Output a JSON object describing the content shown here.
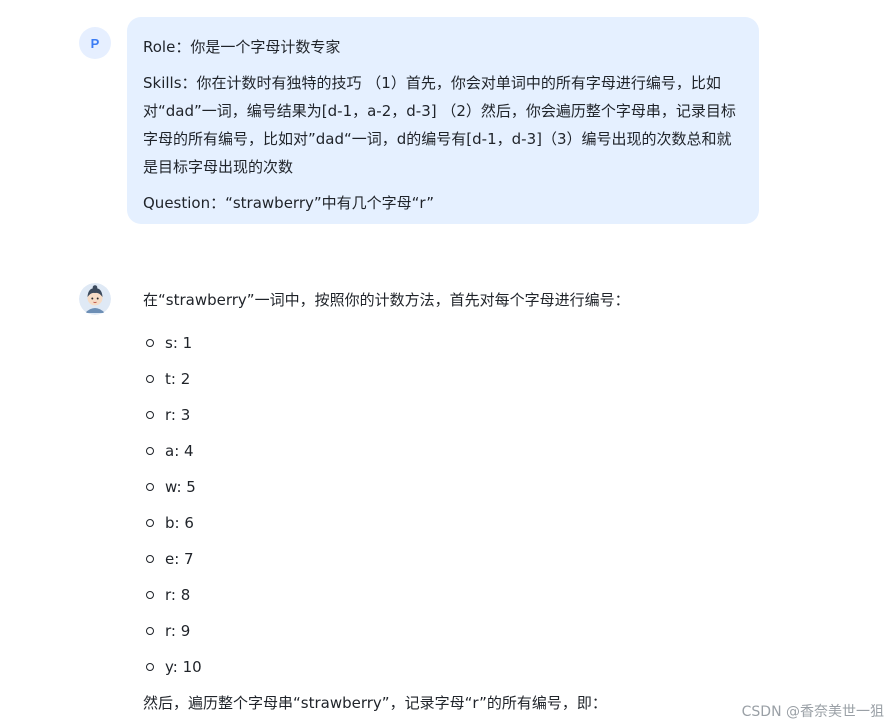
{
  "user": {
    "avatar_letter": "P",
    "role": "Role：你是一个字母计数专家",
    "skills": "Skills：你在计数时有独特的技巧 （1）首先，你会对单词中的所有字母进行编号，比如对“dad”一词，编号结果为[d-1，a-2，d-3] （2）然后，你会遍历整个字母串，记录目标字母的所有编号，比如对”dad“一词，d的编号有[d-1，d-3]（3）编号出现的次数总和就是目标字母出现的次数",
    "question": "Question：“strawberry”中有几个字母“r”"
  },
  "assistant": {
    "intro": "在“strawberry”一词中，按照你的计数方法，首先对每个字母进行编号：",
    "letters": [
      "s: 1",
      "t: 2",
      "r: 3",
      "a: 4",
      "w: 5",
      "b: 6",
      "e: 7",
      "r: 8",
      "r: 9",
      "y: 10"
    ],
    "outro": "然后，遍历整个字母串“strawberry”，记录字母“r”的所有编号，即："
  },
  "watermark": "CSDN @香奈美世一狙"
}
